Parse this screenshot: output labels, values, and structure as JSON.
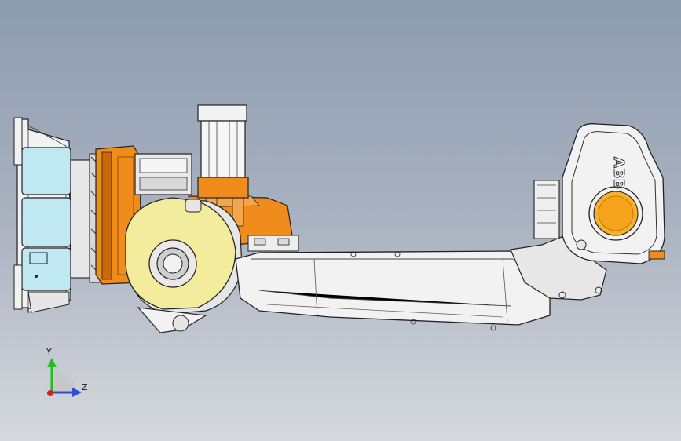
{
  "axes": {
    "y_label": "Y",
    "z_label": "Z"
  },
  "logo": {
    "text": "ABB"
  },
  "colors": {
    "orange": "#f08c1c",
    "orange_dark": "#c96a0a",
    "cyan_panel": "#bfe8f2",
    "cream": "#f3ec9c",
    "body_white": "#f2f2f2",
    "edge": "#222222",
    "axis_y": "#22bb22",
    "axis_z": "#2a4fd6",
    "axis_origin": "#d62020"
  }
}
